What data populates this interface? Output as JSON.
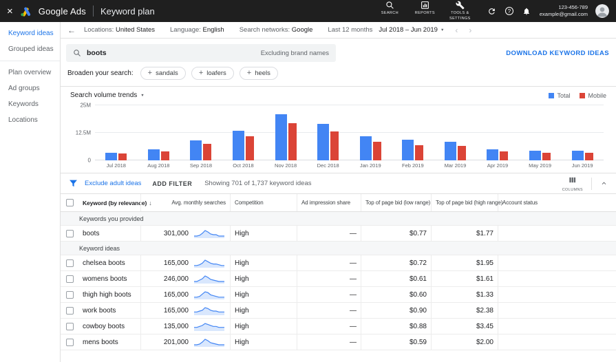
{
  "colors": {
    "accent_blue": "#1a73e8",
    "bar_blue": "#4285f4",
    "bar_red": "#db4437"
  },
  "icons": {
    "close": "×",
    "back": "←",
    "caret": "▼",
    "sort_desc": "↓",
    "prev": "‹",
    "next": "›",
    "help": "?"
  },
  "topbar": {
    "brand": "Google Ads",
    "page_title": "Keyword plan",
    "nav_items": [
      {
        "id": "search",
        "label": "SEARCH"
      },
      {
        "id": "reports",
        "label": "REPORTS"
      },
      {
        "id": "tools",
        "label": "TOOLS & SETTINGS"
      }
    ],
    "account_id": "123-456-789",
    "account_email": "example@gmail.com"
  },
  "toolbar": {
    "segments": [
      {
        "label": "Locations:",
        "value": "United States"
      },
      {
        "label": "Language:",
        "value": "English"
      },
      {
        "label": "Search networks:",
        "value": "Google"
      }
    ],
    "range_label": "Last 12 months",
    "range_value": "Jul 2018 – Jun 2019"
  },
  "sidebar": {
    "groups": [
      [
        {
          "label": "Keyword ideas",
          "active": true
        },
        {
          "label": "Grouped ideas",
          "active": false
        }
      ],
      [
        {
          "label": "Plan overview",
          "active": false
        },
        {
          "label": "Ad groups",
          "active": false
        },
        {
          "label": "Keywords",
          "active": false
        },
        {
          "label": "Locations",
          "active": false
        }
      ]
    ]
  },
  "search_bar": {
    "query": "boots",
    "note": "Excluding brand names",
    "download_label": "DOWNLOAD KEYWORD IDEAS"
  },
  "broaden": {
    "label": "Broaden your search:",
    "chips": [
      "sandals",
      "loafers",
      "heels"
    ]
  },
  "chart_data": {
    "type": "bar",
    "title": "Search volume trends",
    "categories": [
      "Jul 2018",
      "Aug 2018",
      "Sep 2018",
      "Oct 2018",
      "Nov 2018",
      "Dec 2018",
      "Jan 2019",
      "Feb 2019",
      "Mar 2019",
      "Apr 2019",
      "May 2019",
      "Jun 2019"
    ],
    "series": [
      {
        "name": "Total",
        "color": "#4285f4",
        "values": [
          3.5,
          5,
          9,
          13.5,
          21,
          16.5,
          11,
          9.5,
          8.5,
          5,
          4.5,
          4.5
        ]
      },
      {
        "name": "Mobile",
        "color": "#db4437",
        "values": [
          3,
          4,
          7.5,
          11,
          17,
          13,
          8.5,
          7,
          6.5,
          4,
          3.5,
          3.5
        ]
      }
    ],
    "unit": "M",
    "ylim": [
      0,
      25
    ],
    "yticks": [
      {
        "value": 0,
        "label": "0"
      },
      {
        "value": 12.5,
        "label": "12.5M"
      },
      {
        "value": 25,
        "label": "25M"
      }
    ],
    "legend_position": "top-right",
    "grid": true
  },
  "filter_bar": {
    "exclude_label": "Exclude adult ideas",
    "add_filter_label": "ADD FILTER",
    "showing": "Showing 701 of 1,737 keyword ideas",
    "columns_label": "COLUMNS"
  },
  "table": {
    "headers": {
      "keyword": "Keyword (by relevance)",
      "avg_monthly_searches": "Avg. monthly searches",
      "competition": "Competition",
      "ad_impression_share": "Ad impression share",
      "bid_low": "Top of page bid (low range)",
      "bid_high": "Top of page bid (high range)",
      "account_status": "Account status"
    },
    "sections": [
      {
        "title": "Keywords you provided",
        "rows": [
          {
            "keyword": "boots",
            "avg_monthly_searches": "301,000",
            "competition": "High",
            "ad_impression_share": "—",
            "bid_low": "$0.77",
            "bid_high": "$1.77",
            "account_status": "",
            "trend": [
              2,
              2,
              3,
              6,
              10,
              8,
              5,
              4,
              4,
              2,
              2,
              2
            ]
          }
        ]
      },
      {
        "title": "Keyword ideas",
        "rows": [
          {
            "keyword": "chelsea boots",
            "avg_monthly_searches": "165,000",
            "competition": "High",
            "ad_impression_share": "—",
            "bid_low": "$0.72",
            "bid_high": "$1.95",
            "account_status": "",
            "trend": [
              2,
              2,
              3,
              5,
              9,
              7,
              5,
              4,
              4,
              3,
              2,
              2
            ]
          },
          {
            "keyword": "womens boots",
            "avg_monthly_searches": "246,000",
            "competition": "High",
            "ad_impression_share": "—",
            "bid_low": "$0.61",
            "bid_high": "$1.61",
            "account_status": "",
            "trend": [
              2,
              2,
              4,
              6,
              10,
              8,
              5,
              4,
              3,
              2,
              2,
              2
            ]
          },
          {
            "keyword": "thigh high boots",
            "avg_monthly_searches": "165,000",
            "competition": "High",
            "ad_impression_share": "—",
            "bid_low": "$0.60",
            "bid_high": "$1.33",
            "account_status": "",
            "trend": [
              2,
              2,
              3,
              6,
              9,
              8,
              5,
              4,
              3,
              2,
              2,
              2
            ]
          },
          {
            "keyword": "work boots",
            "avg_monthly_searches": "165,000",
            "competition": "High",
            "ad_impression_share": "—",
            "bid_low": "$0.90",
            "bid_high": "$2.38",
            "account_status": "",
            "trend": [
              3,
              3,
              4,
              5,
              8,
              7,
              5,
              4,
              4,
              3,
              3,
              3
            ]
          },
          {
            "keyword": "cowboy boots",
            "avg_monthly_searches": "135,000",
            "competition": "High",
            "ad_impression_share": "—",
            "bid_low": "$0.88",
            "bid_high": "$3.45",
            "account_status": "",
            "trend": [
              3,
              3,
              4,
              5,
              7,
              6,
              5,
              4,
              4,
              3,
              3,
              3
            ]
          },
          {
            "keyword": "mens boots",
            "avg_monthly_searches": "201,000",
            "competition": "High",
            "ad_impression_share": "—",
            "bid_low": "$0.59",
            "bid_high": "$2.00",
            "account_status": "",
            "trend": [
              2,
              2,
              3,
              6,
              10,
              8,
              5,
              4,
              3,
              2,
              2,
              2
            ]
          }
        ]
      }
    ]
  }
}
